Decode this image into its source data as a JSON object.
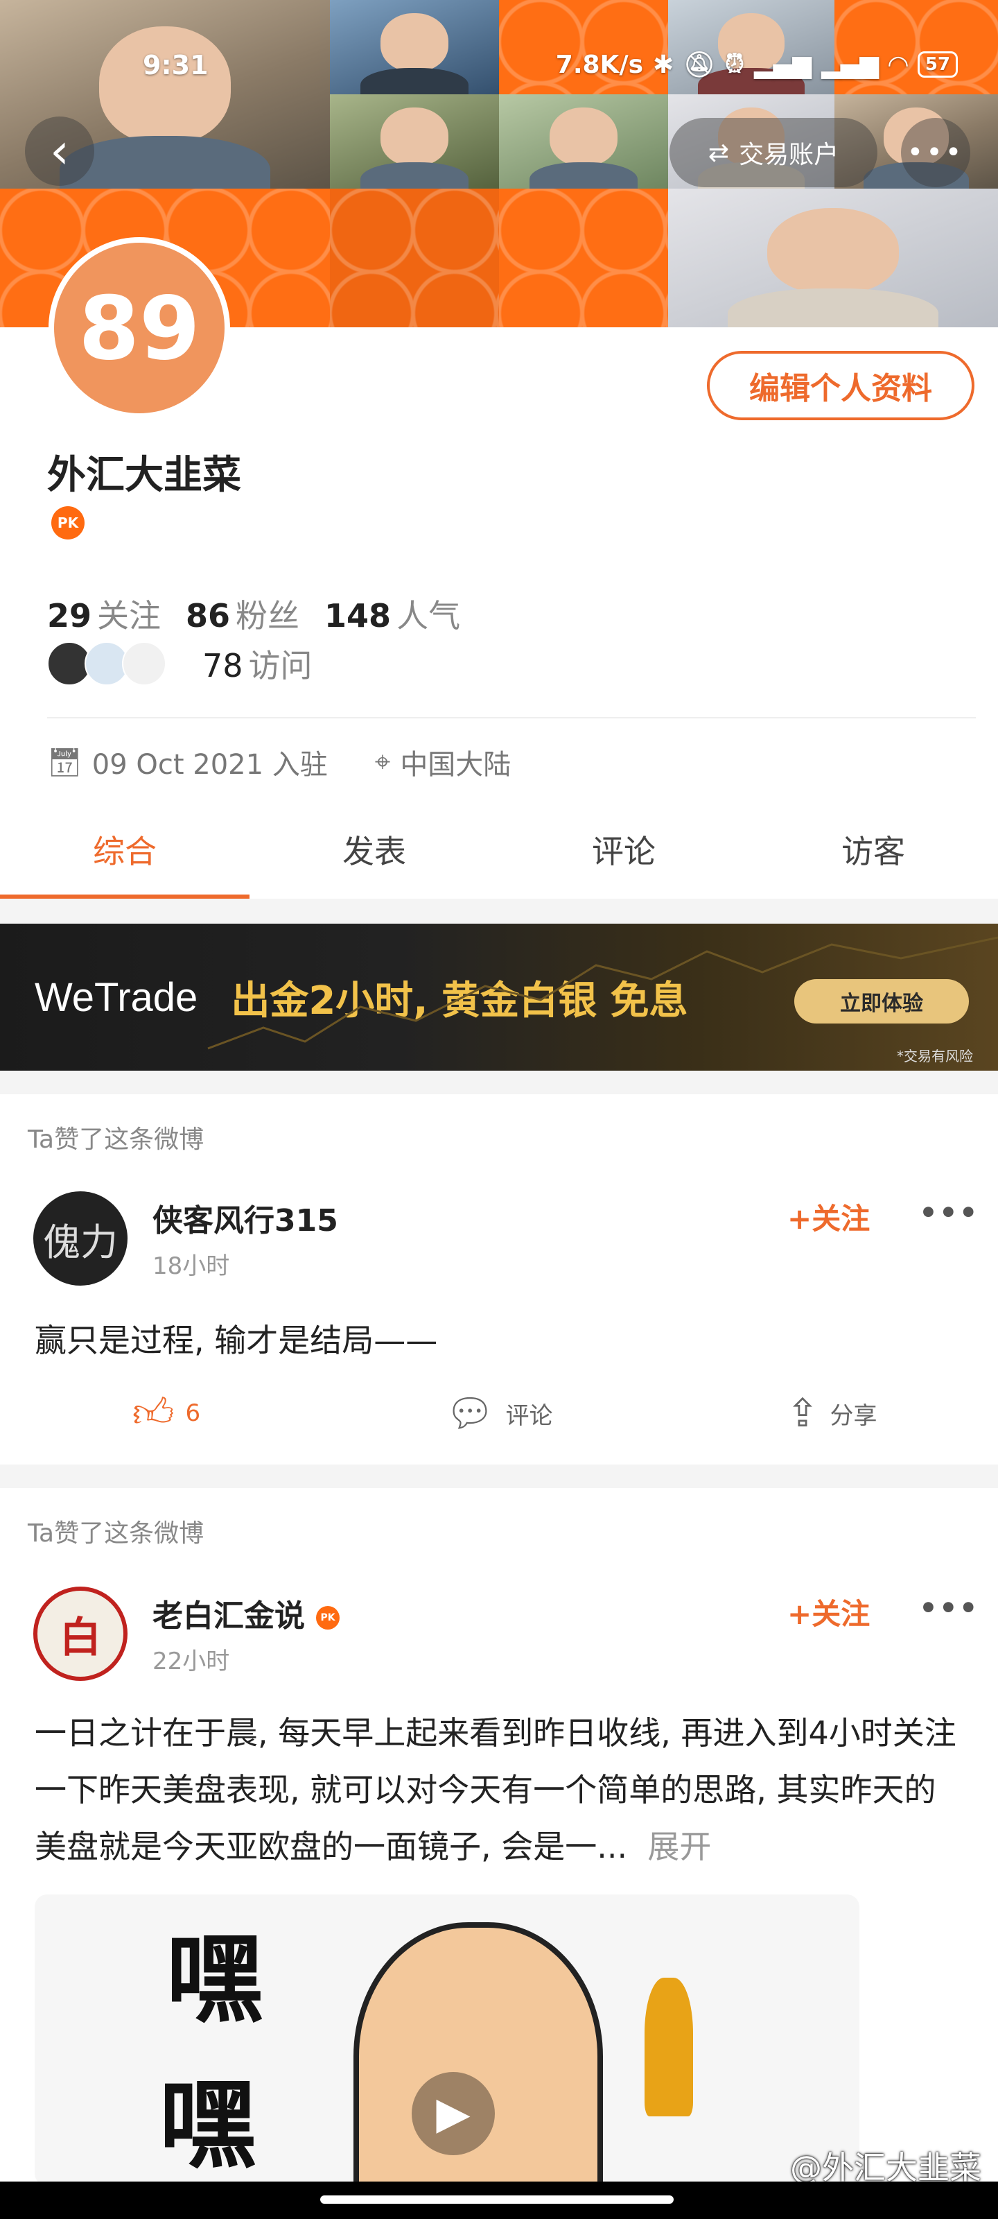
{
  "status_bar": {
    "time": "9:31",
    "speed": "7.8K/s",
    "battery": "57"
  },
  "header": {
    "account_button": "交易账户",
    "back_icon": "back-arrow-icon",
    "more_icon": "more-dots-icon"
  },
  "profile": {
    "avatar_text": "89",
    "edit_button": "编辑个人资料",
    "username": "外汇大韭菜",
    "badge": "PK",
    "stats": [
      {
        "value": "29",
        "label": "关注"
      },
      {
        "value": "86",
        "label": "粉丝"
      },
      {
        "value": "148",
        "label": "人气"
      }
    ],
    "visits_value": "78",
    "visits_label": "访问",
    "join_date": "09 Oct 2021 入驻",
    "location": "中国大陆"
  },
  "tabs": [
    {
      "label": "综合",
      "active": true
    },
    {
      "label": "发表",
      "active": false
    },
    {
      "label": "评论",
      "active": false
    },
    {
      "label": "访客",
      "active": false
    }
  ],
  "ad": {
    "logo": "WeTrade",
    "text": "出金2小时, 黄金白银 免息",
    "button": "立即体验",
    "risk": "*交易有风险"
  },
  "posts": [
    {
      "label": "Ta赞了这条微博",
      "avatar_text": "傀力",
      "name": "侠客风行315",
      "time": "18小时",
      "follow": "+关注",
      "more": "•••",
      "body": "赢只是过程, 输才是结局——",
      "likes": "6",
      "comment": "评论",
      "share": "分享"
    },
    {
      "label": "Ta赞了这条微博",
      "avatar_text": "白",
      "name": "老白汇金说",
      "badge": "PK",
      "time": "22小时",
      "follow": "+关注",
      "more": "•••",
      "body": "一日之计在于晨, 每天早上起来看到昨日收线, 再进入到4小时关注一下昨天美盘表现, 就可以对今天有一个简单的思路, 其实昨天的美盘就是今天亚欧盘的一面镜子, 会是一...",
      "expand": "展开",
      "image_text_1": "嘿",
      "image_text_2": "嘿"
    }
  ],
  "watermark": "@外汇大韭菜"
}
